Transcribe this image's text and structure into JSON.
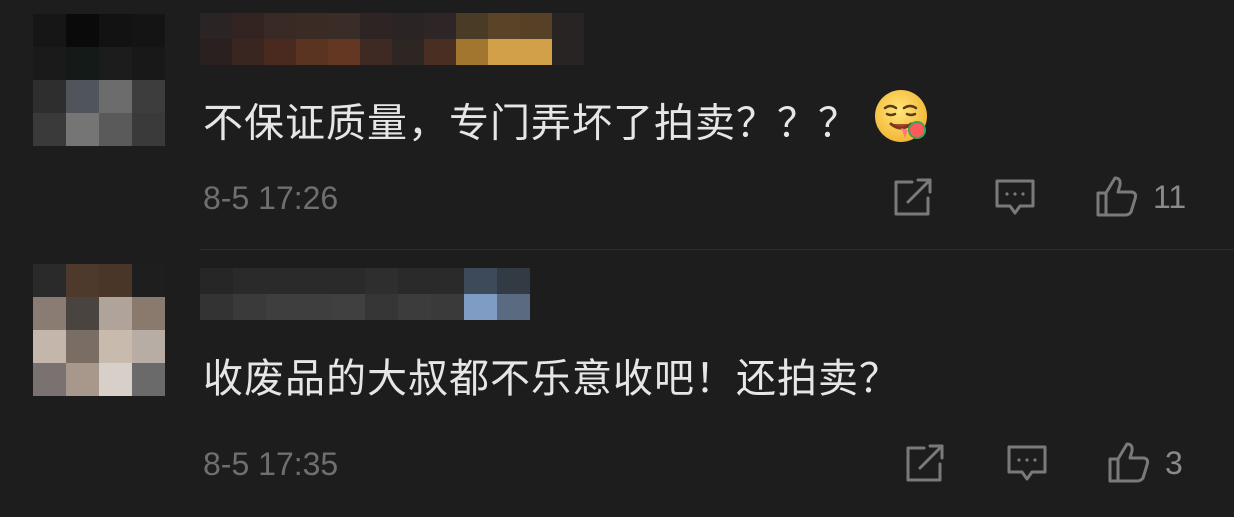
{
  "comments": [
    {
      "username": "",
      "text": "不保证质量，专门弄坏了拍卖？？？",
      "emoji": "drooling-emoji",
      "timestamp": "8-5 17:26",
      "likes": "11",
      "icons": {
        "share": "share-icon",
        "reply": "comment-icon",
        "like": "thumbs-up-icon"
      },
      "avatar_colors": [
        "#161616",
        "#0a0a0a",
        "#121212",
        "#141414",
        "#1a1a1a",
        "#141a18",
        "#1c1c1c",
        "#181818",
        "#2e2e2e",
        "#4f555b",
        "#6c6c6c",
        "#3d3d3d",
        "#3a3a3a",
        "#757575",
        "#5a5a5a",
        "#3a3a3a"
      ],
      "name_colors": [
        "#2b2424",
        "#2a2020",
        "#332421",
        "#3a2620",
        "#3a2a25",
        "#4a2a1e",
        "#3a2b24",
        "#5a3420",
        "#3a2d28",
        "#633721",
        "#2e2424",
        "#3f2a23",
        "#2a2424",
        "#2e2622",
        "#2e2626",
        "#4a2e22",
        "#4a3b26",
        "#a3762f",
        "#5a4326",
        "#d3a04a",
        "#574126",
        "#d3a04a",
        "#292424",
        "#282424"
      ]
    },
    {
      "username": "",
      "text": "收废品的大叔都不乐意收吧！还拍卖？",
      "timestamp": "8-5 17:35",
      "likes": "3",
      "icons": {
        "share": "share-icon",
        "reply": "comment-icon",
        "like": "thumbs-up-icon"
      },
      "avatar_colors": [
        "#2a2a2a",
        "#4e3a2c",
        "#4a3628",
        "#1e1e1e",
        "#8a7c72",
        "#4a4440",
        "#b0a49a",
        "#8a7a6e",
        "#c4b6aa",
        "#7a6e64",
        "#c8baac",
        "#b8ada4",
        "#7a7270",
        "#a8988c",
        "#d6d0c8",
        "#6a6a6a"
      ],
      "name_colors": [
        "#262626",
        "#333333",
        "#2a2a2a",
        "#3a3a3a",
        "#2a2a2a",
        "#3e3e3e",
        "#2a2a2a",
        "#3e3e3e",
        "#2a2a2a",
        "#404040",
        "#2e2e2e",
        "#363636",
        "#2a2a2a",
        "#3c3c3c",
        "#2a2a2a",
        "#3a3a3a",
        "#3c4a5a",
        "#7e9cc4",
        "#323a44",
        "#5a6a80"
      ]
    }
  ]
}
